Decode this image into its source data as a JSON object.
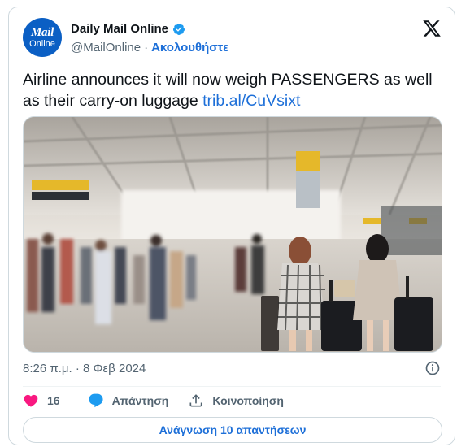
{
  "author": {
    "name": "Daily Mail Online",
    "handle": "@MailOnline",
    "separator": "·",
    "follow_label": "Ακολουθήστε",
    "avatar_line1": "Mail",
    "avatar_line2": "Online",
    "avatar_color": "#0b5fc4",
    "verified_color": "#1d9bf0"
  },
  "tweet": {
    "text": "Airline announces it will now weigh PASSENGERS as well as their carry-on luggage ",
    "link": "trib.al/CuVsixt",
    "timestamp": "8:26 π.μ. · 8 Φεβ 2024"
  },
  "media": {
    "description_icon": "airport-terminal-photo",
    "sign_gate": "CD 1–E 8"
  },
  "actions": {
    "like_count": "16",
    "reply_label": "Απάντηση",
    "share_label": "Κοινοποίηση",
    "like_color": "#f91880",
    "reply_color": "#1d9bf0"
  },
  "footer": {
    "read_replies_label": "Ανάγνωση 10 απαντήσεων"
  }
}
